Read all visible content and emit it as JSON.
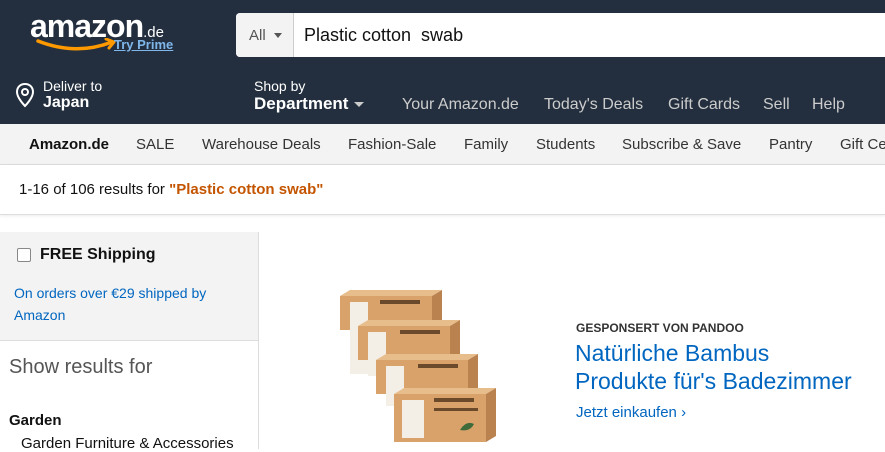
{
  "header": {
    "logo": {
      "wordmark": "amazon",
      "tld": ".de",
      "prime_link": "Try Prime"
    },
    "search": {
      "category": "All",
      "query": "Plastic cotton  swab"
    },
    "deliver": {
      "line1": "Deliver to",
      "line2": "Japan",
      "icon": "location-pin-icon"
    },
    "shop_by": {
      "line1": "Shop by",
      "line2": "Department"
    },
    "nav_links": [
      "Your Amazon.de",
      "Today's Deals",
      "Gift Cards",
      "Sell",
      "Help"
    ]
  },
  "subnav": [
    "Amazon.de",
    "SALE",
    "Warehouse Deals",
    "Fashion-Sale",
    "Family",
    "Students",
    "Subscribe & Save",
    "Pantry",
    "Gift Ce"
  ],
  "results": {
    "prefix": "1-16 of 106 results for ",
    "query": "\"Plastic cotton swab\""
  },
  "sidebar": {
    "free_shipping": "FREE Shipping",
    "free_shipping_checked": false,
    "shipping_note": "On orders over €29 shipped by Amazon",
    "show_results": "Show results for",
    "category": "Garden",
    "subcategory": "Garden Furniture & Accessories"
  },
  "ad": {
    "sponsored": "GESPONSERT VON PANDOO",
    "headline_line1": "Natürliche Bambus",
    "headline_line2": "Produkte für's Badezimmer",
    "cta": "Jetzt einkaufen",
    "box_brand": "pandoo",
    "box_label": "BAMBUS WATTESTÄBCHEN"
  },
  "colors": {
    "header_bg": "#232f3e",
    "logo_smile": "#ff9900",
    "link": "#0066c0",
    "query_highlight": "#c45500"
  }
}
